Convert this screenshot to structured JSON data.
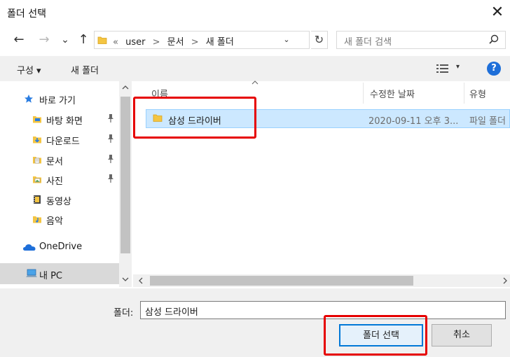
{
  "window": {
    "title": "폴더 선택",
    "close_glyph": "✕"
  },
  "address": {
    "crumbs": [
      "«",
      "user",
      ">",
      "문서",
      ">",
      "새 폴더"
    ],
    "dropdown_glyph": "⌄",
    "refresh_glyph": "↻"
  },
  "nav_buttons": {
    "back": "←",
    "forward": "→",
    "recent": "⌄",
    "up": "↑"
  },
  "search": {
    "placeholder": "새 폴더 검색",
    "icon": "search-icon"
  },
  "toolbar": {
    "organize": "구성 ▾",
    "new_folder": "새 폴더",
    "view_dropdown": "▾",
    "help": "?"
  },
  "nav_pane": {
    "items": [
      {
        "label": "바로 가기",
        "icon": "star-icon",
        "pinned": false
      },
      {
        "label": "바탕 화면",
        "icon": "desktop-folder-icon",
        "pinned": true
      },
      {
        "label": "다운로드",
        "icon": "downloads-folder-icon",
        "pinned": true
      },
      {
        "label": "문서",
        "icon": "documents-folder-icon",
        "pinned": true
      },
      {
        "label": "사진",
        "icon": "pictures-folder-icon",
        "pinned": true
      },
      {
        "label": "동영상",
        "icon": "videos-folder-icon",
        "pinned": false
      },
      {
        "label": "음악",
        "icon": "music-folder-icon",
        "pinned": false
      },
      {
        "label": "OneDrive",
        "icon": "onedrive-icon",
        "pinned": false
      },
      {
        "label": "내 PC",
        "icon": "this-pc-icon",
        "pinned": false
      }
    ],
    "pin_glyph": "📌"
  },
  "file_list": {
    "columns": [
      "이름",
      "수정한 날짜",
      "유형"
    ],
    "rows": [
      {
        "name": "삼성 드라이버",
        "date": "2020-09-11 오후 3...",
        "type": "파일 폴더"
      }
    ]
  },
  "bottom": {
    "folder_label": "폴더:",
    "folder_value": "삼성 드라이버",
    "select_button": "폴더 선택",
    "cancel_button": "취소"
  },
  "colors": {
    "accent": "#0078d7",
    "selection": "#cce8ff",
    "highlight_box": "#e60000",
    "folder_yellow": "#f4c542"
  }
}
